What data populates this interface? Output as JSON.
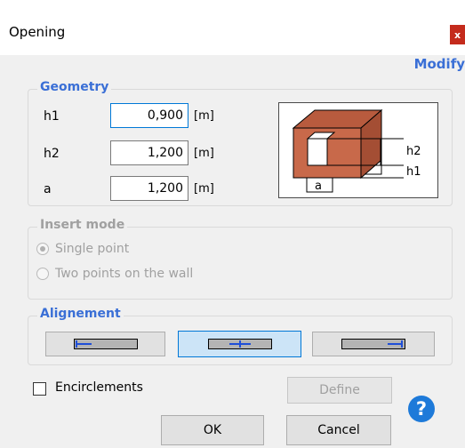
{
  "window": {
    "title": "Opening",
    "close_label": "x"
  },
  "mode_label": "Modify",
  "geometry": {
    "legend": "Geometry",
    "fields": [
      {
        "label": "h1",
        "value": "0,900",
        "unit": "[m]"
      },
      {
        "label": "h2",
        "value": "1,200",
        "unit": "[m]"
      },
      {
        "label": "a",
        "value": "1,200",
        "unit": "[m]"
      }
    ],
    "sketch_labels": {
      "h2": "h2",
      "h1": "h1",
      "a": "a"
    }
  },
  "insert_mode": {
    "legend": "Insert mode",
    "options": [
      {
        "label": "Single point",
        "selected": true
      },
      {
        "label": "Two points on the wall",
        "selected": false
      }
    ]
  },
  "alignment": {
    "legend": "Alignement",
    "options": [
      "left",
      "center",
      "right"
    ],
    "selected": "center"
  },
  "encirclements": {
    "label": "Encirclements",
    "checked": false
  },
  "buttons": {
    "define": "Define",
    "ok": "OK",
    "cancel": "Cancel"
  },
  "help": {
    "glyph": "?"
  },
  "colors": {
    "accent": "#3a6fd6",
    "brick": "#c8694a",
    "close": "#c42b1c",
    "help": "#1e7ad9"
  }
}
